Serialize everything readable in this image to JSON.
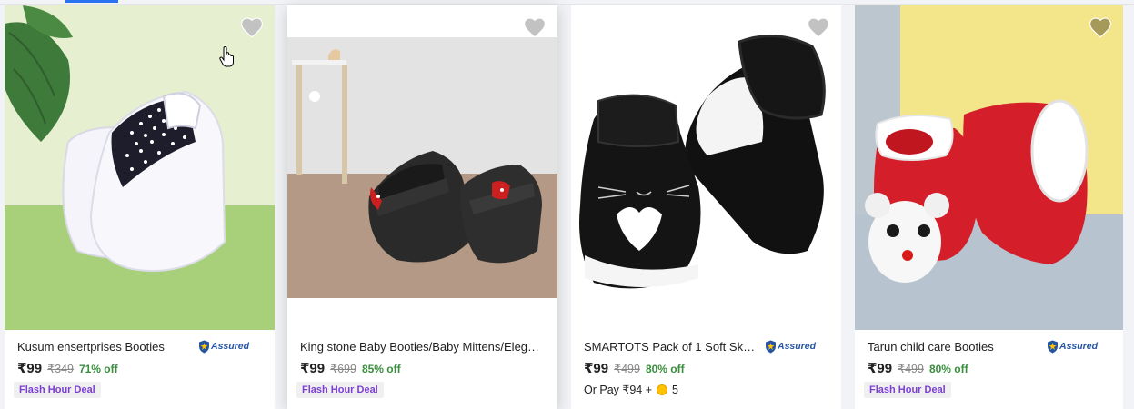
{
  "products": [
    {
      "title": "Kusum ensertprises Booties",
      "assured": "Assured",
      "price": "₹99",
      "mrp": "₹349",
      "discount": "71% off",
      "badge": "Flash Hour Deal",
      "image_desc": "white-polka-dot-booties"
    },
    {
      "title": "King stone Baby Booties/Baby Mittens/Elegen...",
      "price": "₹99",
      "mrp": "₹699",
      "discount": "85% off",
      "badge": "Flash Hour Deal",
      "image_desc": "black-cat-sandals"
    },
    {
      "title": "SMARTOTS Pack of 1 Soft Skin-...",
      "assured": "Assured",
      "price": "₹99",
      "mrp": "₹499",
      "discount": "80% off",
      "pay_prefix": "Or Pay ₹94 +",
      "coins": "5"
    },
    {
      "title": "Tarun child care Booties",
      "assured": "Assured",
      "price": "₹99",
      "mrp": "₹499",
      "discount": "80% off",
      "badge": "Flash Hour Deal"
    }
  ],
  "colors": {
    "price_green": "#388e3c",
    "deal_purple": "#7b3fd6",
    "assured_blue": "#2455a4",
    "accent_blue": "#2874f0"
  },
  "icons": [
    "heart-icon",
    "assured-shield-icon",
    "supercoin-icon",
    "hand-cursor-icon"
  ]
}
